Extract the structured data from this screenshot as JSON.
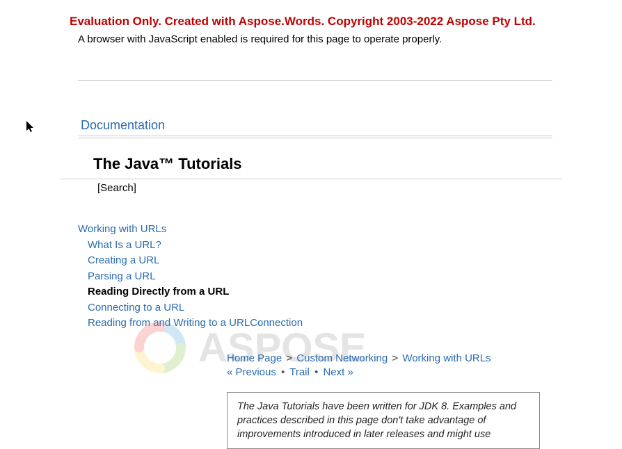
{
  "banner": {
    "eval_text": "Evaluation Only. Created with Aspose.Words. Copyright 2003-2022 Aspose Pty Ltd.",
    "js_warning": "A browser with JavaScript enabled is required for this page to operate properly."
  },
  "doc_link": "Documentation",
  "title": "The Java™ Tutorials",
  "search_label": "[Search]",
  "nav": {
    "section": "Working with URLs",
    "items": [
      "What Is a URL?",
      "Creating a URL",
      "Parsing a URL",
      "Reading Directly from a URL",
      "Connecting to a URL",
      "Reading from and Writing to a URLConnection"
    ],
    "current_index": 3
  },
  "breadcrumb": {
    "home": "Home Page",
    "trail1": "Custom Networking",
    "trail2": "Working with URLs",
    "sep": ">"
  },
  "pager": {
    "prev": "« Previous",
    "trail": "Trail",
    "next": "Next »",
    "dot": "•"
  },
  "note": "The Java Tutorials have been written for JDK 8. Examples and practices described in this page don't take advantage of improvements introduced in later releases and might use",
  "watermark_text": "ASPOSE"
}
